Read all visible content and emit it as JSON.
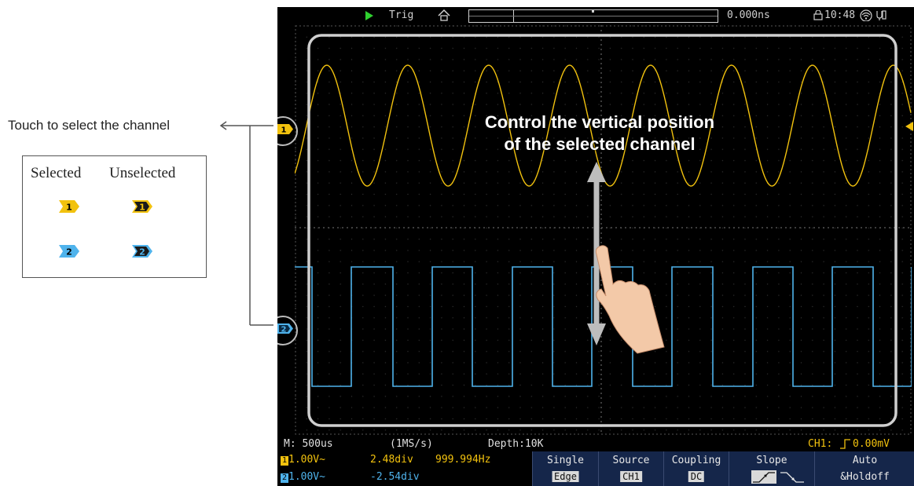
{
  "annotation": {
    "touch_label": "Touch to select the channel",
    "legend": {
      "selected_header": "Selected",
      "unselected_header": "Unselected"
    }
  },
  "scope": {
    "topbar": {
      "status": "Trig",
      "time_offset": "0.000ns",
      "clock": "10:48"
    },
    "overlay": {
      "line1": "Control the vertical position",
      "line2": "of the selected channel"
    },
    "infobar": {
      "timebase": "M: 500us",
      "sample_rate": "(1MS/s)",
      "depth": "Depth:10K",
      "trigger": "CH1:",
      "trigger_level": "0.00mV"
    },
    "channels": [
      {
        "id": "1",
        "scale": "1.00V~",
        "position": "2.48div",
        "frequency": "999.994Hz",
        "color": "#f2c20e"
      },
      {
        "id": "2",
        "scale": "1.00V~",
        "position": "-2.54div",
        "frequency": "",
        "color": "#4fb3ec"
      }
    ],
    "menu": [
      {
        "title": "Single",
        "value": "Edge"
      },
      {
        "title": "Source",
        "value": "CH1"
      },
      {
        "title": "Coupling",
        "value": "DC"
      },
      {
        "title": "Slope",
        "value": ""
      },
      {
        "title": "Auto",
        "value": "&Holdoff"
      }
    ]
  },
  "colors": {
    "ch1": "#f2c20e",
    "ch2": "#4fb3ec",
    "frame": "#cfcfcf",
    "menu_bg": "#15264a"
  }
}
